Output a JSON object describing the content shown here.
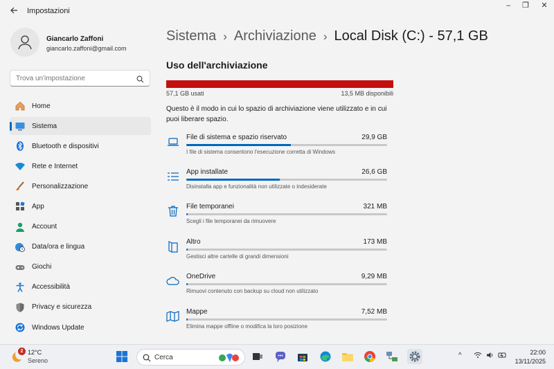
{
  "window": {
    "title": "Impostazioni",
    "controls": {
      "minimize": "–",
      "maximize": "❐",
      "close": "✕"
    }
  },
  "user": {
    "name": "Giancarlo Zaffoni",
    "email": "giancarlo.zaffoni@gmail.com"
  },
  "search": {
    "placeholder": "Trova un'impostazione"
  },
  "sidebar": {
    "items": [
      {
        "label": "Home",
        "icon": "home-icon"
      },
      {
        "label": "Sistema",
        "icon": "system-icon",
        "selected": true
      },
      {
        "label": "Bluetooth e dispositivi",
        "icon": "bluetooth-icon"
      },
      {
        "label": "Rete e Internet",
        "icon": "wifi-icon"
      },
      {
        "label": "Personalizzazione",
        "icon": "brush-icon"
      },
      {
        "label": "App",
        "icon": "apps-icon"
      },
      {
        "label": "Account",
        "icon": "account-icon"
      },
      {
        "label": "Data/ora e lingua",
        "icon": "globe-clock-icon"
      },
      {
        "label": "Giochi",
        "icon": "gamepad-icon"
      },
      {
        "label": "Accessibilità",
        "icon": "accessibility-icon"
      },
      {
        "label": "Privacy e sicurezza",
        "icon": "shield-icon"
      },
      {
        "label": "Windows Update",
        "icon": "update-icon"
      }
    ]
  },
  "breadcrumb": {
    "items": [
      "Sistema",
      "Archiviazione",
      "Local Disk (C:) - 57,1 GB"
    ],
    "separator": "›"
  },
  "storage": {
    "title": "Uso dell'archiviazione",
    "used": "57,1 GB usati",
    "free": "13,5 MB disponibili",
    "used_fraction": 0.9998,
    "description": "Questo è il modo in cui lo spazio di archiviazione viene utilizzato e in cui puoi liberare spazio.",
    "categories": [
      {
        "name": "File di sistema e spazio riservato",
        "size": "29,9 GB",
        "fraction": 0.52,
        "desc": "I file di sistema consentono l'esecuzione corretta di Windows",
        "icon": "laptop-icon"
      },
      {
        "name": "App installate",
        "size": "26,6 GB",
        "fraction": 0.465,
        "desc": "Disinstalla app e funzionalità non utilizzate o indesiderate",
        "icon": "app-list-icon"
      },
      {
        "name": "File temporanei",
        "size": "321 MB",
        "fraction": 0.006,
        "desc": "Scegli i file temporanei da rimuovere",
        "icon": "trash-icon"
      },
      {
        "name": "Altro",
        "size": "173 MB",
        "fraction": 0.003,
        "desc": "Gestisci altre cartelle di grandi dimensioni",
        "icon": "book-icon"
      },
      {
        "name": "OneDrive",
        "size": "9,29 MB",
        "fraction": 0.0002,
        "desc": "Rimuovi contenuto con backup su cloud non utilizzato",
        "icon": "cloud-icon"
      },
      {
        "name": "Mappe",
        "size": "7,52 MB",
        "fraction": 0.0001,
        "desc": "Elimina mappe offline o modifica la loro posizione",
        "icon": "map-icon"
      }
    ]
  },
  "taskbar": {
    "weather": {
      "badge": "2",
      "temp": "12°C",
      "condition": "Sereno"
    },
    "search_label": "Cerca",
    "clock": {
      "time": "22:00",
      "date": "13/11/2025"
    },
    "tray_chevron": "^"
  },
  "colors": {
    "accent": "#0067c0",
    "usage_bar": "#c50f0f",
    "background": "#f3f3f3"
  }
}
